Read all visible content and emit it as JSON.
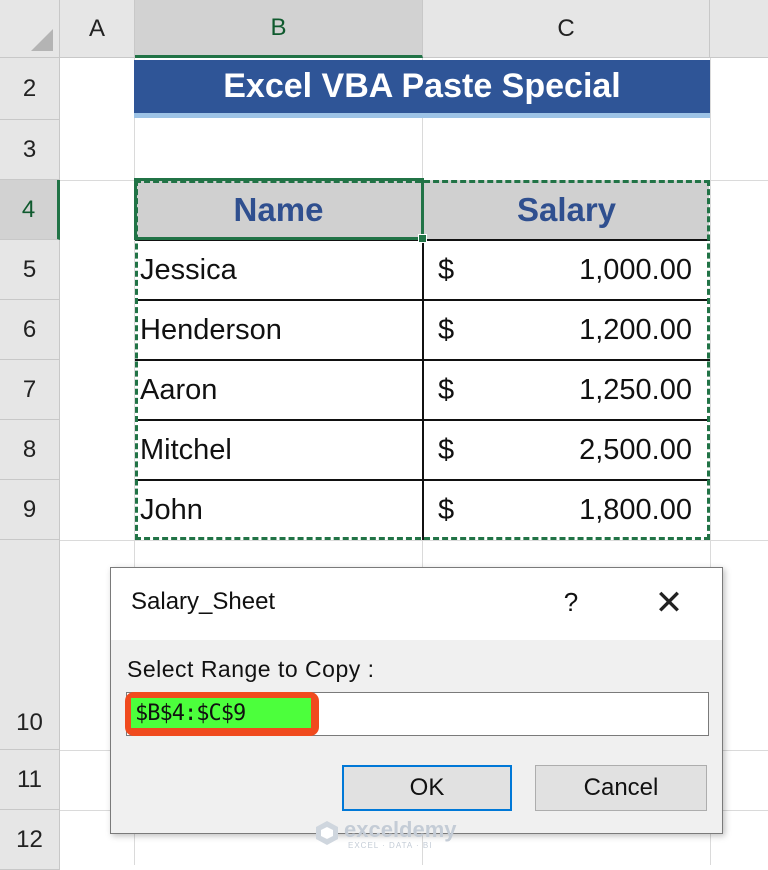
{
  "columns": [
    "A",
    "B",
    "C"
  ],
  "rows": [
    "2",
    "3",
    "4",
    "5",
    "6",
    "7",
    "8",
    "9",
    "10",
    "11",
    "12"
  ],
  "banner_title": "Excel VBA Paste Special",
  "table": {
    "headers": [
      "Name",
      "Salary"
    ],
    "rows": [
      {
        "name": "Jessica",
        "currency": "$",
        "salary": "1,000.00"
      },
      {
        "name": "Henderson",
        "currency": "$",
        "salary": "1,200.00"
      },
      {
        "name": "Aaron",
        "currency": "$",
        "salary": "1,250.00"
      },
      {
        "name": "Mitchel",
        "currency": "$",
        "salary": "2,500.00"
      },
      {
        "name": "John",
        "currency": "$",
        "salary": "1,800.00"
      }
    ]
  },
  "dialog": {
    "title": "Salary_Sheet",
    "help": "?",
    "close": "✕",
    "label": "Select Range to Copy :",
    "input_value": "$B$4:$C$9",
    "ok_label": "OK",
    "cancel_label": "Cancel"
  },
  "watermark": {
    "main": "exceldemy",
    "sub": "EXCEL · DATA · BI"
  },
  "colors": {
    "selection": "#217346",
    "banner": "#2f5597",
    "highlight": "#4cff3c",
    "outline": "#f04a1e"
  }
}
